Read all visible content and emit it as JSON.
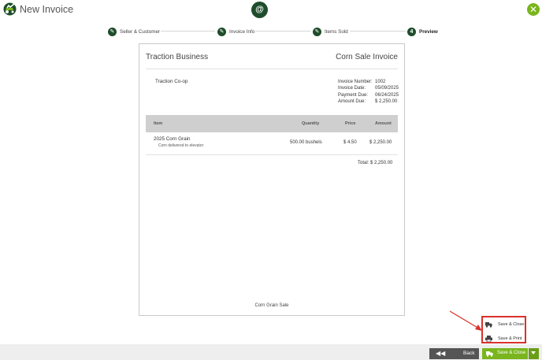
{
  "window": {
    "title": "New Invoice",
    "center_badge": "@",
    "close_glyph": "✕"
  },
  "colors": {
    "brand_dark": "#1e4d2b",
    "brand_green": "#7ab51d",
    "annotation_red": "#d9322b"
  },
  "stepper": {
    "steps": [
      {
        "label": "Seller & Customer",
        "state": "complete",
        "marker": "✎"
      },
      {
        "label": "Invoice Info",
        "state": "complete",
        "marker": "✎"
      },
      {
        "label": "Items Sold",
        "state": "complete",
        "marker": "✎"
      },
      {
        "label": "Preview",
        "state": "active",
        "marker": "4"
      }
    ]
  },
  "invoice": {
    "company": "Traction Business",
    "title": "Corn Sale Invoice",
    "customer": "Traction Co-op",
    "meta": [
      {
        "label": "Invoice Number:",
        "value": "1002"
      },
      {
        "label": "Invoice Date:",
        "value": "05/09/2025"
      },
      {
        "label": "Payment Due:",
        "value": "06/24/2025"
      },
      {
        "label": "Amount Due:",
        "value": "$ 2,250.00"
      }
    ],
    "columns": {
      "item": "Item",
      "quantity": "Quantity",
      "price": "Price",
      "amount": "Amount"
    },
    "items": [
      {
        "name": "2025 Corn Grain",
        "description": "Corn delivered to elevator",
        "quantity": "500.00 bushels",
        "price": "$ 4.50",
        "amount": "$ 2,250.00"
      }
    ],
    "total": "Total: $ 2,250.00",
    "footer": "Corn Grain Sale"
  },
  "popup_menu": {
    "items": [
      {
        "label": "Save & Close",
        "icon": "truck-icon"
      },
      {
        "label": "Save & Print",
        "icon": "printer-icon"
      }
    ]
  },
  "footer_bar": {
    "back_label": "Back",
    "back_icon": "rewind-icon",
    "save_label": "Save & Close",
    "save_icon": "truck-icon",
    "menu_icon": "caret-down-icon"
  }
}
